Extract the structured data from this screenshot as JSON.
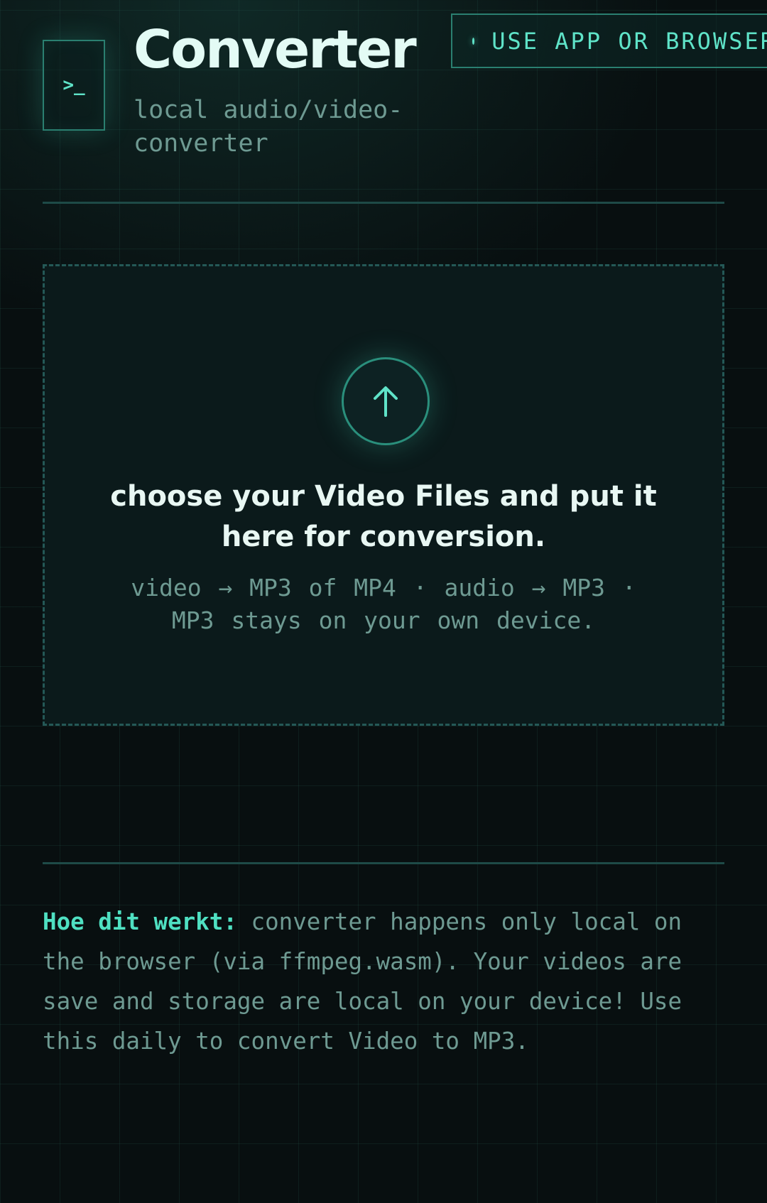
{
  "header": {
    "logo_glyph": ">_",
    "title": "Converter",
    "subtitle": "local audio/video-converter",
    "badge": "USE APP OR BROWSER"
  },
  "dropzone": {
    "icon": "upload-arrow-icon",
    "heading": "choose your Video Files and put it here for conversion.",
    "hint": "video → MP3 of MP4 · audio → MP3 · MP3 stays on your own device."
  },
  "info": {
    "label": "Hoe dit werkt:",
    "text": " converter happens only local on the browser (via ffmpeg.wasm). Your videos are save and storage are local on your device! Use this daily to convert Video to MP3."
  },
  "colors": {
    "background": "#080f10",
    "accent": "#5fe3c8",
    "title": "#e3fbf5",
    "muted": "#6e9a92",
    "border": "#2a7f70"
  }
}
